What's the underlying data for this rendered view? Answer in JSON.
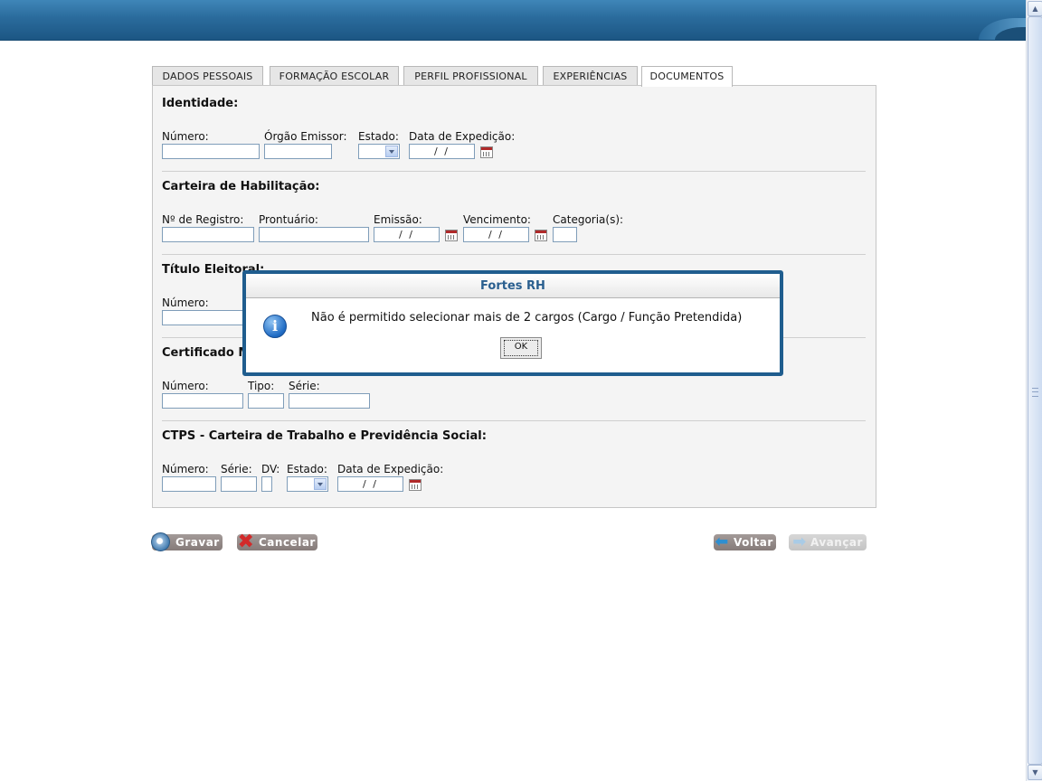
{
  "tabs": [
    "DADOS PESSOAIS",
    "FORMAÇÃO ESCOLAR",
    "PERFIL PROFISSIONAL",
    "EXPERIÊNCIAS",
    "DOCUMENTOS"
  ],
  "active_tab": "DOCUMENTOS",
  "identidade": {
    "title": "Identidade:",
    "numero": "Número:",
    "orgao": "Órgão Emissor:",
    "estado": "Estado:",
    "data": "Data de Expedição:",
    "data_value": "/ /"
  },
  "habilitacao": {
    "title": "Carteira de Habilitação:",
    "registro": "Nº de Registro:",
    "prontuario": "Prontuário:",
    "emissao": "Emissão:",
    "vencimento": "Vencimento:",
    "categoria": "Categoria(s):",
    "emissao_value": "/ /",
    "vencimento_value": "/ /"
  },
  "titulo": {
    "title": "Título Eleitoral:",
    "numero": "Número:"
  },
  "certificado": {
    "title": "Certificado M",
    "numero": "Número:",
    "tipo": "Tipo:",
    "serie": "Série:"
  },
  "ctps": {
    "title": "CTPS - Carteira de Trabalho e Previdência Social:",
    "numero": "Número:",
    "serie": "Série:",
    "dv": "DV:",
    "estado": "Estado:",
    "data": "Data de Expedição:",
    "data_value": "/ /"
  },
  "buttons": {
    "gravar": "Gravar",
    "cancelar": "Cancelar",
    "voltar": "Voltar",
    "avancar": "Avançar"
  },
  "dialog": {
    "title": "Fortes RH",
    "message": "Não é permitido selecionar mais de 2 cargos (Cargo / Função Pretendida)",
    "ok": "OK",
    "icon": "info-icon"
  },
  "colors": {
    "banner": "#2a6b9c",
    "dialog_border": "#1f5d8e",
    "button": "#857b79"
  }
}
